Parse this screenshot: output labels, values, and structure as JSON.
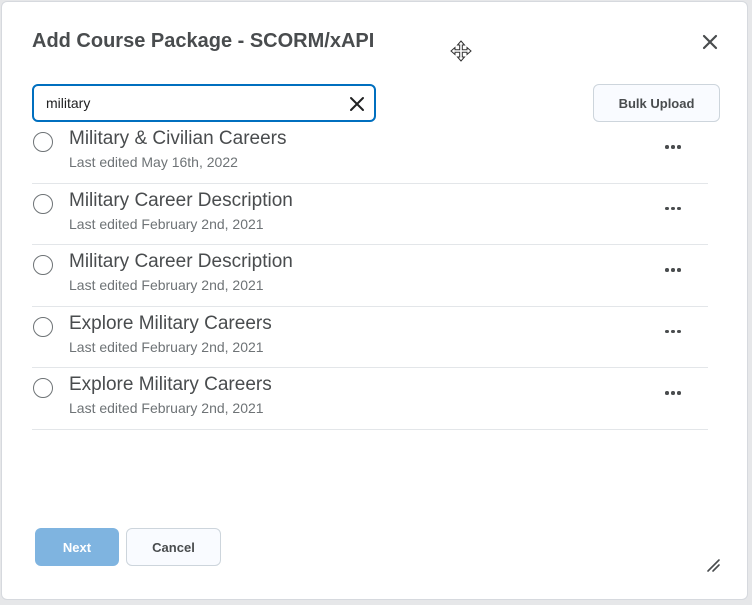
{
  "dialog": {
    "title": "Add Course Package - SCORM/xAPI",
    "move_icon": "move-cursor-icon",
    "close_icon": "close-icon"
  },
  "search": {
    "value": "military",
    "clear_icon": "clear-icon"
  },
  "toolbar": {
    "bulk_upload_label": "Bulk Upload"
  },
  "packages": [
    {
      "title": "Military & Civilian Careers",
      "subtitle": "Last edited May 16th, 2022"
    },
    {
      "title": "Military Career Description",
      "subtitle": "Last edited February 2nd, 2021"
    },
    {
      "title": "Military Career Description",
      "subtitle": "Last edited February 2nd, 2021"
    },
    {
      "title": "Explore Military Careers",
      "subtitle": "Last edited February 2nd, 2021"
    },
    {
      "title": "Explore Military Careers",
      "subtitle": "Last edited February 2nd, 2021"
    }
  ],
  "footer": {
    "next_label": "Next",
    "cancel_label": "Cancel",
    "resize_icon": "resize-handle-icon"
  },
  "colors": {
    "accent": "#006fbf",
    "primary_disabled": "#7fb4e0",
    "text": "#494c4e",
    "subtext": "#6e7376"
  }
}
